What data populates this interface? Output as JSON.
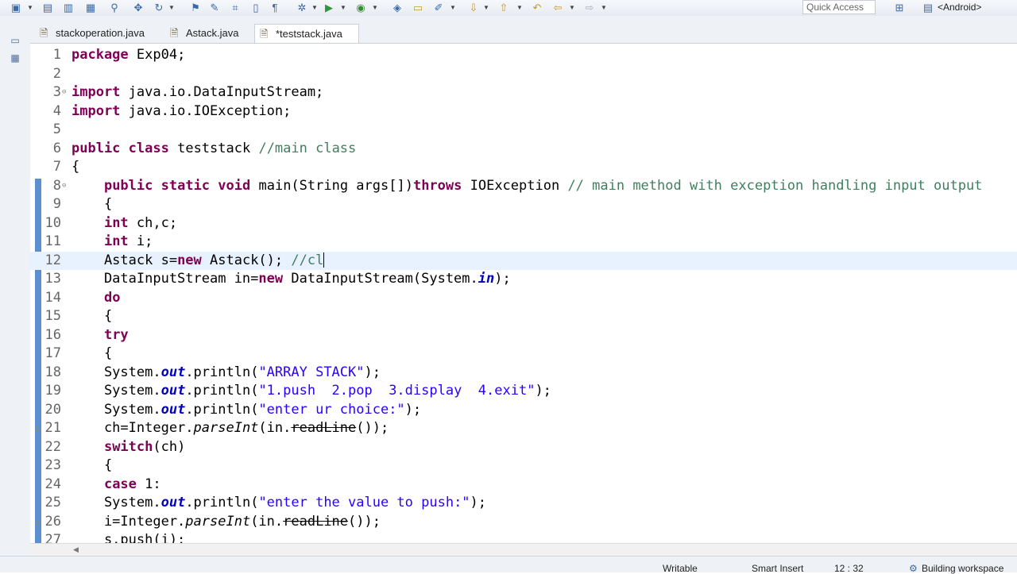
{
  "toolbar": {
    "quick_access_placeholder": "Quick Access",
    "perspective_label": "<Android>",
    "icons": [
      "new-icon",
      "save-icon",
      "save-all-icon",
      "print-icon",
      "search-icon",
      "debug-icon",
      "run-icon",
      "coverage-icon",
      "open-type-icon",
      "open-task-icon",
      "next-annotation-icon",
      "back-icon",
      "forward-icon"
    ]
  },
  "tabs": [
    {
      "label": "stackoperation.java",
      "active": false
    },
    {
      "label": "Astack.java",
      "active": false
    },
    {
      "label": "*teststack.java",
      "active": true
    }
  ],
  "editor": {
    "current_line": 12,
    "lines": [
      {
        "n": "1",
        "t": [
          "package Exp04;"
        ]
      },
      {
        "n": "2",
        "t": [
          ""
        ]
      },
      {
        "n": "3",
        "t": [
          "import java.io.DataInputStream;"
        ]
      },
      {
        "n": "4",
        "t": [
          "import java.io.IOException;"
        ]
      },
      {
        "n": "5",
        "t": [
          ""
        ]
      },
      {
        "n": "6",
        "t": [
          "public class teststack //main class"
        ]
      },
      {
        "n": "7",
        "t": [
          "{"
        ]
      },
      {
        "n": "8",
        "t": [
          "    public static void main(String args[])throws IOException // main method with exception handling input output"
        ]
      },
      {
        "n": "9",
        "t": [
          "    {"
        ]
      },
      {
        "n": "10",
        "t": [
          "    int ch,c;"
        ]
      },
      {
        "n": "11",
        "t": [
          "    int i;"
        ]
      },
      {
        "n": "12",
        "t": [
          "    Astack s=new Astack(); //cl"
        ]
      },
      {
        "n": "13",
        "t": [
          "    DataInputStream in=new DataInputStream(System.in);"
        ]
      },
      {
        "n": "14",
        "t": [
          "    do"
        ]
      },
      {
        "n": "15",
        "t": [
          "    {"
        ]
      },
      {
        "n": "16",
        "t": [
          "    try"
        ]
      },
      {
        "n": "17",
        "t": [
          "    {"
        ]
      },
      {
        "n": "18",
        "t": [
          "    System.out.println(\"ARRAY STACK\");"
        ]
      },
      {
        "n": "19",
        "t": [
          "    System.out.println(\"1.push  2.pop  3.display  4.exit\");"
        ]
      },
      {
        "n": "20",
        "t": [
          "    System.out.println(\"enter ur choice:\");"
        ]
      },
      {
        "n": "21",
        "t": [
          "    ch=Integer.parseInt(in.readLine());"
        ]
      },
      {
        "n": "22",
        "t": [
          "    switch(ch)"
        ]
      },
      {
        "n": "23",
        "t": [
          "    {"
        ]
      },
      {
        "n": "24",
        "t": [
          "    case 1:"
        ]
      },
      {
        "n": "25",
        "t": [
          "    System.out.println(\"enter the value to push:\");"
        ]
      },
      {
        "n": "26",
        "t": [
          "    i=Integer.parseInt(in.readLine());"
        ]
      },
      {
        "n": "27",
        "t": [
          "    s.push(i);"
        ]
      }
    ]
  },
  "status": {
    "writable": "Writable",
    "insert_mode": "Smart Insert",
    "position": "12 : 32",
    "progress": "Building workspace"
  },
  "colors": {
    "keyword": "#7f0055",
    "comment": "#3f7f5f",
    "string": "#2a00ff",
    "static_field": "#0000c0",
    "current_line_bg": "#e8f2fe"
  }
}
